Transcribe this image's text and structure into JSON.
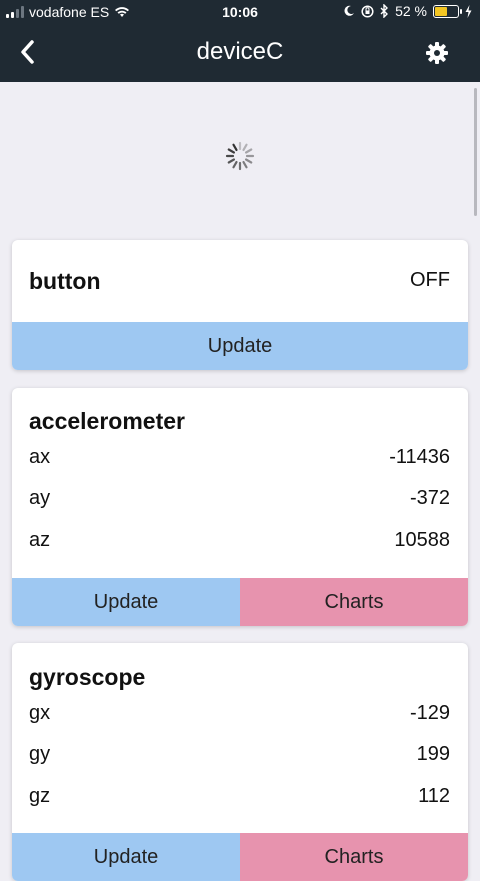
{
  "status_bar": {
    "carrier": "vodafone ES",
    "time": "10:06",
    "battery": "52 %",
    "battery_level": 0.52,
    "battery_color": "#f3c623"
  },
  "nav": {
    "title": "deviceC",
    "back_icon": "chevron-left-icon",
    "settings_icon": "gear-icon"
  },
  "sensors": {
    "button": {
      "title": "button",
      "value": "OFF",
      "update_label": "Update"
    },
    "accelerometer": {
      "title": "accelerometer",
      "rows": [
        {
          "label": "ax",
          "value": "-11436"
        },
        {
          "label": "ay",
          "value": "-372"
        },
        {
          "label": "az",
          "value": "10588"
        }
      ],
      "update_label": "Update",
      "charts_label": "Charts"
    },
    "gyroscope": {
      "title": "gyroscope",
      "rows": [
        {
          "label": "gx",
          "value": "-129"
        },
        {
          "label": "gy",
          "value": "199"
        },
        {
          "label": "gz",
          "value": "112"
        }
      ],
      "update_label": "Update",
      "charts_label": "Charts"
    }
  },
  "colors": {
    "nav_background": "#1f2a33",
    "update_button": "#9ec8f2",
    "charts_button": "#e793ae",
    "page_background": "#efeef4"
  }
}
